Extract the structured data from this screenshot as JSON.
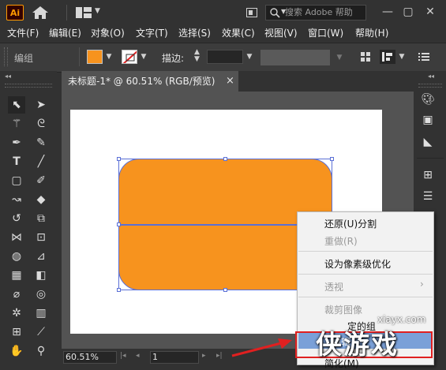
{
  "app": {
    "logo_text": "Ai",
    "search_placeholder": "搜索 Adobe 帮助"
  },
  "menu": [
    "文件(F)",
    "编辑(E)",
    "对象(O)",
    "文字(T)",
    "选择(S)",
    "效果(C)",
    "视图(V)",
    "窗口(W)",
    "帮助(H)"
  ],
  "control_bar": {
    "selection_label": "编组",
    "stroke_label": "描边:",
    "fill_color": "#f7931e"
  },
  "document": {
    "tab_title": "未标题-1* @ 60.51% (RGB/预览)",
    "close": "×"
  },
  "status": {
    "zoom": "60.51%",
    "page": "1"
  },
  "context_menu": {
    "items": [
      {
        "label": "还原(U)分割",
        "enabled": true
      },
      {
        "label": "重做(R)",
        "enabled": false
      },
      {
        "label": "设为像素级优化",
        "enabled": true
      },
      {
        "label": "透视",
        "enabled": false
      },
      {
        "label": "裁剪图像",
        "enabled": false
      },
      {
        "label": "定的组",
        "enabled": true
      },
      {
        "label": "编辑",
        "enabled": true
      },
      {
        "label": "简化(M)",
        "enabled": true
      }
    ]
  },
  "watermark": {
    "url": "xiayx.com",
    "logo": "侠游戏"
  },
  "colors": {
    "accent": "#f7931e",
    "selection": "#5a6fd6",
    "annotation": "#e02020"
  }
}
